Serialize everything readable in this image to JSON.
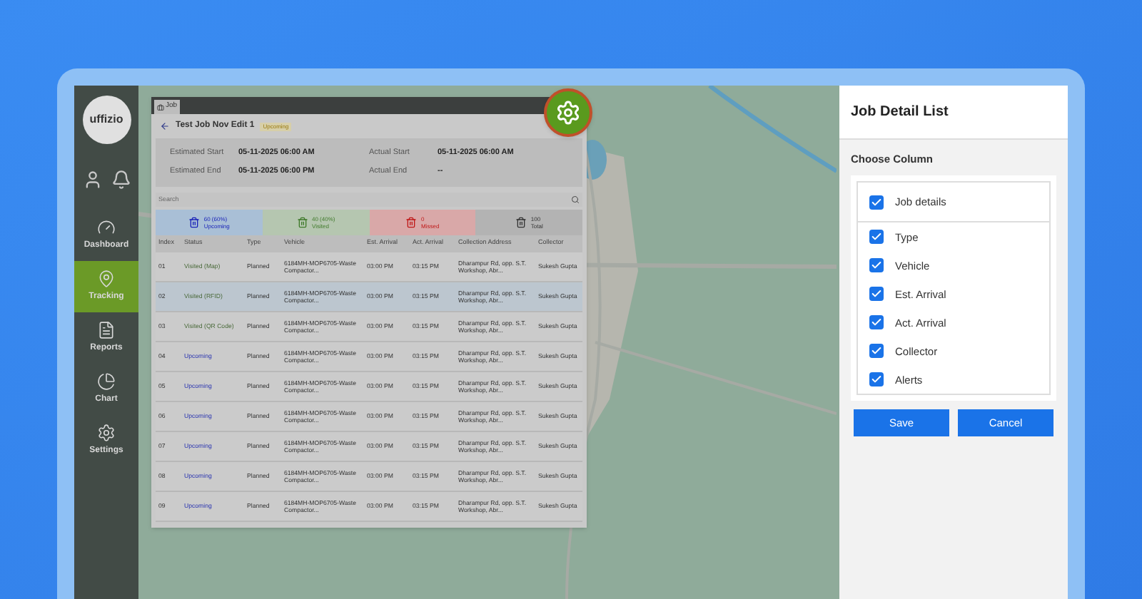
{
  "sidebar": {
    "logo": "uffizio",
    "items": [
      {
        "label": "Dashboard",
        "selected": false
      },
      {
        "label": "Tracking",
        "selected": true
      },
      {
        "label": "Reports",
        "selected": false
      },
      {
        "label": "Chart",
        "selected": false
      },
      {
        "label": "Settings",
        "selected": false
      }
    ]
  },
  "job_window": {
    "tab": "Job",
    "title": "Test Job Nov Edit 1",
    "badge": "Upcoming",
    "dates": [
      {
        "label": "Estimated Start",
        "value": "05-11-2025 06:00 AM"
      },
      {
        "label": "Estimated End",
        "value": "05-11-2025 06:00 PM"
      },
      {
        "label": "Actual Start",
        "value": "05-11-2025 06:00 AM"
      },
      {
        "label": "Actual End",
        "value": "--"
      }
    ],
    "search": {
      "placeholder": "Search"
    },
    "stats": [
      {
        "value": "60 (60%)",
        "label": "Upcoming",
        "color": "#1a23b8"
      },
      {
        "value": "40 (40%)",
        "label": "Visited",
        "color": "#3f7a2a"
      },
      {
        "value": "0",
        "label": "Missed",
        "color": "#c01818"
      },
      {
        "value": "100",
        "label": "Total",
        "color": "#333333"
      }
    ],
    "table": {
      "columns": [
        "Index",
        "Status",
        "Type",
        "Vehicle",
        "Est. Arrival",
        "Act. Arrival",
        "Collection Address",
        "Collector"
      ],
      "rows": [
        {
          "selected": false,
          "kind": "visited",
          "cells": [
            "01",
            "Visited (Map)",
            "Planned",
            "6184MH-MOP6705-Waste Compactor...",
            "03:00 PM",
            "03:15 PM",
            "Dharampur Rd, opp. S.T. Workshop, Abr...",
            "Sukesh Gupta"
          ]
        },
        {
          "selected": true,
          "kind": "visited",
          "cells": [
            "02",
            "Visited (RFID)",
            "Planned",
            "6184MH-MOP6705-Waste Compactor...",
            "03:00 PM",
            "03:15 PM",
            "Dharampur Rd, opp. S.T. Workshop, Abr...",
            "Sukesh Gupta"
          ]
        },
        {
          "selected": false,
          "kind": "visited",
          "cells": [
            "03",
            "Visited (QR Code)",
            "Planned",
            "6184MH-MOP6705-Waste Compactor...",
            "03:00 PM",
            "03:15 PM",
            "Dharampur Rd, opp. S.T. Workshop, Abr...",
            "Sukesh Gupta"
          ]
        },
        {
          "selected": false,
          "kind": "upcoming",
          "cells": [
            "04",
            "Upcoming",
            "Planned",
            "6184MH-MOP6705-Waste Compactor...",
            "03:00 PM",
            "03:15 PM",
            "Dharampur Rd, opp. S.T. Workshop, Abr...",
            "Sukesh Gupta"
          ]
        },
        {
          "selected": false,
          "kind": "upcoming",
          "cells": [
            "05",
            "Upcoming",
            "Planned",
            "6184MH-MOP6705-Waste Compactor...",
            "03:00 PM",
            "03:15 PM",
            "Dharampur Rd, opp. S.T. Workshop, Abr...",
            "Sukesh Gupta"
          ]
        },
        {
          "selected": false,
          "kind": "upcoming",
          "cells": [
            "06",
            "Upcoming",
            "Planned",
            "6184MH-MOP6705-Waste Compactor...",
            "03:00 PM",
            "03:15 PM",
            "Dharampur Rd, opp. S.T. Workshop, Abr...",
            "Sukesh Gupta"
          ]
        },
        {
          "selected": false,
          "kind": "upcoming",
          "cells": [
            "07",
            "Upcoming",
            "Planned",
            "6184MH-MOP6705-Waste Compactor...",
            "03:00 PM",
            "03:15 PM",
            "Dharampur Rd, opp. S.T. Workshop, Abr...",
            "Sukesh Gupta"
          ]
        },
        {
          "selected": false,
          "kind": "upcoming",
          "cells": [
            "08",
            "Upcoming",
            "Planned",
            "6184MH-MOP6705-Waste Compactor...",
            "03:00 PM",
            "03:15 PM",
            "Dharampur Rd, opp. S.T. Workshop, Abr...",
            "Sukesh Gupta"
          ]
        },
        {
          "selected": false,
          "kind": "upcoming",
          "cells": [
            "09",
            "Upcoming",
            "Planned",
            "6184MH-MOP6705-Waste Compactor...",
            "03:00 PM",
            "03:15 PM",
            "Dharampur Rd, opp. S.T. Workshop, Abr...",
            "Sukesh Gupta"
          ]
        }
      ]
    }
  },
  "panel": {
    "title": "Job Detail List",
    "subtitle": "Choose Column",
    "header_option": {
      "label": "Job details",
      "checked": true
    },
    "options": [
      {
        "label": "Type",
        "checked": true
      },
      {
        "label": "Vehicle",
        "checked": true
      },
      {
        "label": "Est. Arrival",
        "checked": true
      },
      {
        "label": "Act. Arrival",
        "checked": true
      },
      {
        "label": "Collector",
        "checked": true
      },
      {
        "label": "Alerts",
        "checked": true
      }
    ],
    "buttons": [
      "Save",
      "Cancel"
    ]
  }
}
